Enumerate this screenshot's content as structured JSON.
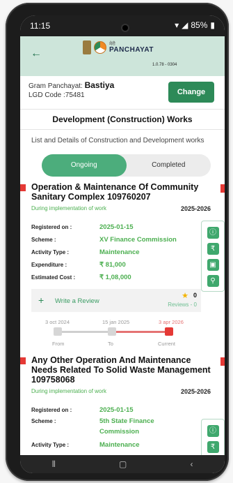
{
  "status_bar": {
    "time": "11:15",
    "battery": "85%"
  },
  "app": {
    "brand_meri": "मेरी",
    "brand_name": "PANCHAYAT",
    "version": "1.0.78 - 0304"
  },
  "panchayat": {
    "label": "Gram Panchayat:",
    "name": "Bastiya",
    "lgd_code": "LGD Code :75481",
    "change_label": "Change"
  },
  "page": {
    "title": "Development (Construction) Works",
    "subtitle": "List and Details of Construction and Development works"
  },
  "tabs": {
    "ongoing": "Ongoing",
    "completed": "Completed",
    "active": "Ongoing"
  },
  "works": [
    {
      "title": "Operation & Maintenance Of Community Sanitary Complex  109760207",
      "status": "During implementation of work",
      "year": "2025-2026",
      "registered_label": "Registered on :",
      "registered": "2025-01-15",
      "scheme_label": "Scheme :",
      "scheme": "XV Finance Commission",
      "activity_label": "Activity Type :",
      "activity": "Maintenance",
      "expenditure_label": "Expenditure :",
      "expenditure": "₹ 81,000",
      "cost_label": "Estimated Cost :",
      "cost": "₹ 1,08,000",
      "review_label": "Write a Review",
      "rating": "0",
      "reviews": "Reviews - 0",
      "timeline": {
        "from_date": "3 oct 2024",
        "to_date": "15 jan 2025",
        "current_date": "3 apr 2026",
        "from_label": "From",
        "to_label": "To",
        "current_label": "Current"
      }
    },
    {
      "title": "Any Other Operation And Maintenance Needs Related To Solid Waste Management 109758068",
      "status": "During implementation of work",
      "year": "2025-2026",
      "registered_label": "Registered on :",
      "registered": "2025-01-15",
      "scheme_label": "Scheme :",
      "scheme": "5th State Finance Commission",
      "activity_label": "Activity Type :",
      "activity": "Maintenance"
    }
  ],
  "colors": {
    "accent": "#2d8a58",
    "header_bg": "#cde5da",
    "marker": "#e53935"
  }
}
